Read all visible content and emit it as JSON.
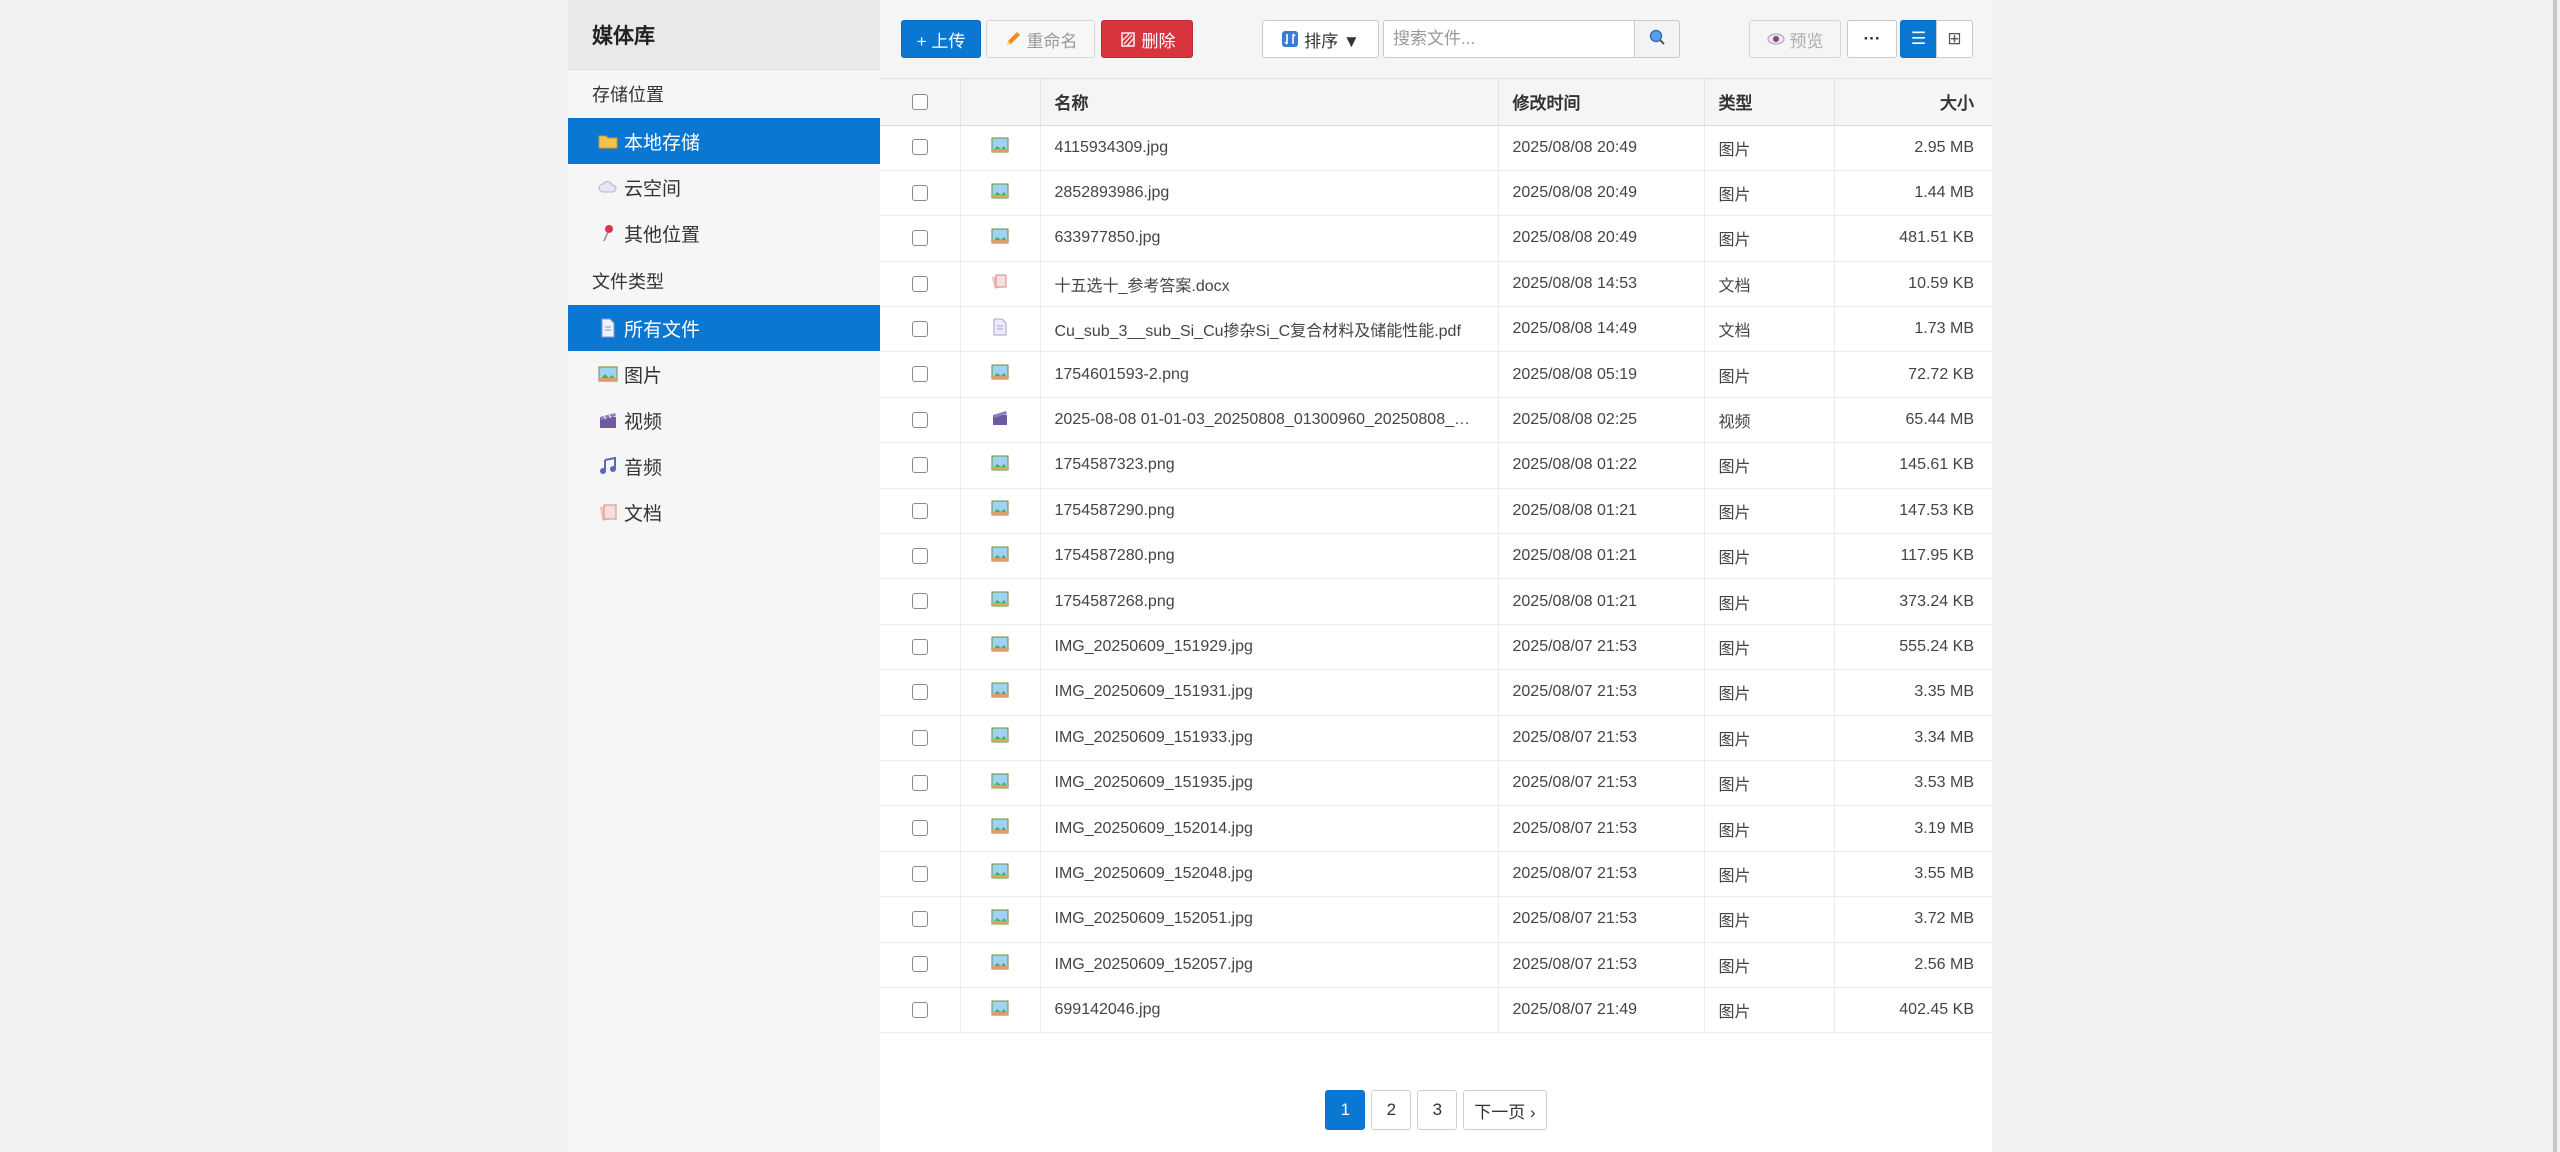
{
  "sidebar": {
    "title": "媒体库",
    "storage_title": "存储位置",
    "storage_items": [
      {
        "label": "本地存储",
        "icon": "folder-icon",
        "active": true
      },
      {
        "label": "云空间",
        "icon": "cloud-icon",
        "active": false
      },
      {
        "label": "其他位置",
        "icon": "pin-icon",
        "active": false
      }
    ],
    "type_title": "文件类型",
    "type_items": [
      {
        "label": "所有文件",
        "icon": "document-icon",
        "active": true
      },
      {
        "label": "图片",
        "icon": "image-icon",
        "active": false
      },
      {
        "label": "视频",
        "icon": "video-icon",
        "active": false
      },
      {
        "label": "音频",
        "icon": "music-icon",
        "active": false
      },
      {
        "label": "文档",
        "icon": "doc-icon",
        "active": false
      }
    ]
  },
  "toolbar": {
    "upload_label": "+ 上传",
    "rename_label": "重命名",
    "delete_label": "删除",
    "sort_label": "排序 ▼",
    "search_placeholder": "搜索文件...",
    "preview_label": "预览",
    "more_label": "···",
    "list_view_label": "☰",
    "grid_view_label": "⊞"
  },
  "table": {
    "headers": {
      "name": "名称",
      "modified": "修改时间",
      "type": "类型",
      "size": "大小"
    },
    "rows": [
      {
        "name": "4115934309.jpg",
        "modified": "2025/08/08 20:49",
        "type": "图片",
        "size": "2.95 MB",
        "kind": "image"
      },
      {
        "name": "2852893986.jpg",
        "modified": "2025/08/08 20:49",
        "type": "图片",
        "size": "1.44 MB",
        "kind": "image"
      },
      {
        "name": "633977850.jpg",
        "modified": "2025/08/08 20:49",
        "type": "图片",
        "size": "481.51 KB",
        "kind": "image"
      },
      {
        "name": "十五选十_参考答案.docx",
        "modified": "2025/08/08 14:53",
        "type": "文档",
        "size": "10.59 KB",
        "kind": "doc"
      },
      {
        "name": "Cu_sub_3__sub_Si_Cu掺杂Si_C复合材料及储能性能.pdf",
        "modified": "2025/08/08 14:49",
        "type": "文档",
        "size": "1.73 MB",
        "kind": "pdf"
      },
      {
        "name": "1754601593-2.png",
        "modified": "2025/08/08 05:19",
        "type": "图片",
        "size": "72.72 KB",
        "kind": "image"
      },
      {
        "name": "2025-08-08 01-01-03_20250808_01300960_20250808_…",
        "modified": "2025/08/08 02:25",
        "type": "视频",
        "size": "65.44 MB",
        "kind": "video"
      },
      {
        "name": "1754587323.png",
        "modified": "2025/08/08 01:22",
        "type": "图片",
        "size": "145.61 KB",
        "kind": "image"
      },
      {
        "name": "1754587290.png",
        "modified": "2025/08/08 01:21",
        "type": "图片",
        "size": "147.53 KB",
        "kind": "image"
      },
      {
        "name": "1754587280.png",
        "modified": "2025/08/08 01:21",
        "type": "图片",
        "size": "117.95 KB",
        "kind": "image"
      },
      {
        "name": "1754587268.png",
        "modified": "2025/08/08 01:21",
        "type": "图片",
        "size": "373.24 KB",
        "kind": "image"
      },
      {
        "name": "IMG_20250609_151929.jpg",
        "modified": "2025/08/07 21:53",
        "type": "图片",
        "size": "555.24 KB",
        "kind": "image"
      },
      {
        "name": "IMG_20250609_151931.jpg",
        "modified": "2025/08/07 21:53",
        "type": "图片",
        "size": "3.35 MB",
        "kind": "image"
      },
      {
        "name": "IMG_20250609_151933.jpg",
        "modified": "2025/08/07 21:53",
        "type": "图片",
        "size": "3.34 MB",
        "kind": "image"
      },
      {
        "name": "IMG_20250609_151935.jpg",
        "modified": "2025/08/07 21:53",
        "type": "图片",
        "size": "3.53 MB",
        "kind": "image"
      },
      {
        "name": "IMG_20250609_152014.jpg",
        "modified": "2025/08/07 21:53",
        "type": "图片",
        "size": "3.19 MB",
        "kind": "image"
      },
      {
        "name": "IMG_20250609_152048.jpg",
        "modified": "2025/08/07 21:53",
        "type": "图片",
        "size": "3.55 MB",
        "kind": "image"
      },
      {
        "name": "IMG_20250609_152051.jpg",
        "modified": "2025/08/07 21:53",
        "type": "图片",
        "size": "3.72 MB",
        "kind": "image"
      },
      {
        "name": "IMG_20250609_152057.jpg",
        "modified": "2025/08/07 21:53",
        "type": "图片",
        "size": "2.56 MB",
        "kind": "image"
      },
      {
        "name": "699142046.jpg",
        "modified": "2025/08/07 21:49",
        "type": "图片",
        "size": "402.45 KB",
        "kind": "image"
      }
    ]
  },
  "pagination": {
    "pages": [
      "1",
      "2",
      "3"
    ],
    "current": "1",
    "next_label": "下一页 ›"
  },
  "colors": {
    "accent": "#0a78d2",
    "danger": "#d8343e"
  }
}
